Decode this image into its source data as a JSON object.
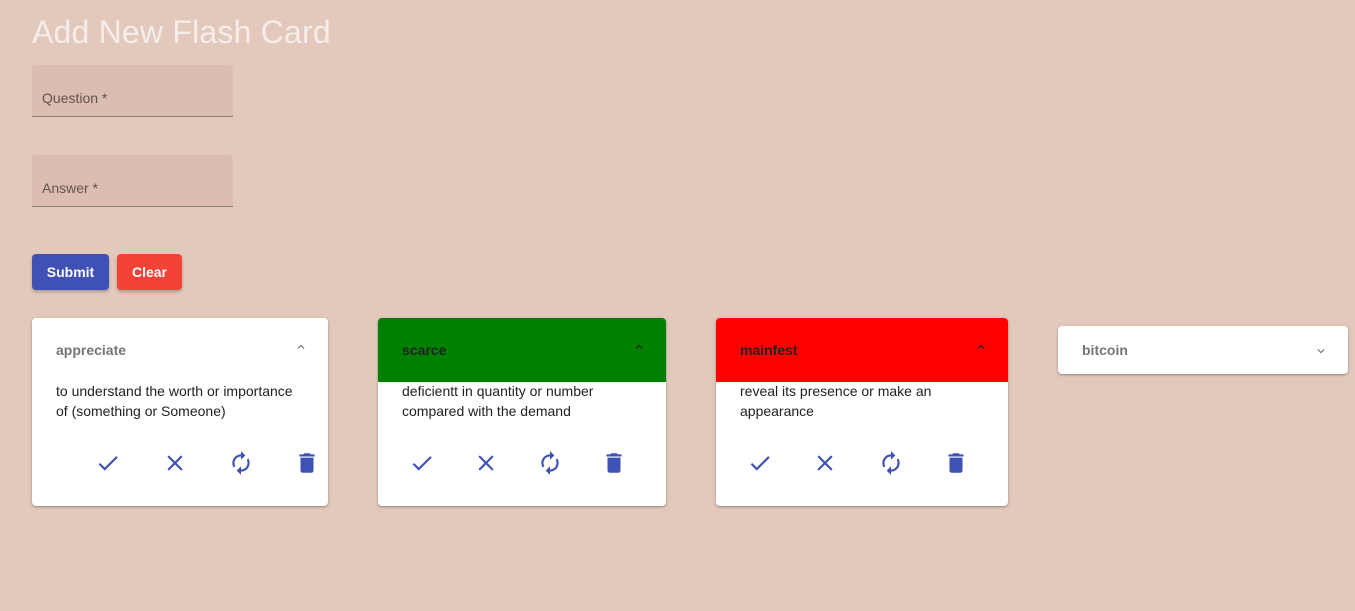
{
  "page_title": "Add New Flash Card",
  "form": {
    "question_placeholder": "Question *",
    "answer_placeholder": "Answer *",
    "submit_label": "Submit",
    "clear_label": "Clear"
  },
  "colors": {
    "background": "#e2c9bc",
    "primary": "#3f51b5",
    "danger": "#f44336",
    "correct": "#008000",
    "wrong": "#ff0000"
  },
  "cards": [
    {
      "title": "appreciate",
      "answer": "to understand the worth or importance of (something or Someone)",
      "status": "none",
      "expanded": true,
      "actions": [
        "check-icon",
        "close-icon",
        "refresh-icon",
        "delete-icon"
      ]
    },
    {
      "title": "scarce",
      "answer": "deficientt in quantity or number compared with the demand",
      "status": "correct",
      "expanded": true,
      "actions": [
        "check-icon",
        "close-icon",
        "refresh-icon",
        "delete-icon"
      ]
    },
    {
      "title": "mainfest",
      "answer": "reveal its presence or make an appearance",
      "status": "wrong",
      "expanded": true,
      "actions": [
        "check-icon",
        "close-icon",
        "refresh-icon",
        "delete-icon"
      ]
    },
    {
      "title": "bitcoin",
      "status": "none",
      "expanded": false
    }
  ]
}
